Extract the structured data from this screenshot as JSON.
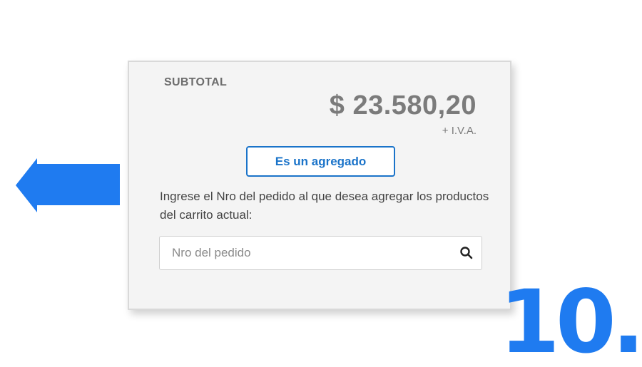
{
  "colors": {
    "accent": "#1f7bf0",
    "button_border": "#1a73c9",
    "card_background": "#f4f4f4"
  },
  "arrow": {
    "icon": "left-arrow-icon"
  },
  "summary": {
    "subtotal_label": "SUBTOTAL",
    "amount": "$ 23.580,20",
    "tax_note": "+ I.V.A."
  },
  "agregado_button": {
    "label": "Es un agregado"
  },
  "instructions": "Ingrese el Nro del pedido al que desea agregar los productos del carrito actual:",
  "search": {
    "placeholder": "Nro del pedido",
    "value": "",
    "icon": "search-icon"
  },
  "step_number": "10."
}
